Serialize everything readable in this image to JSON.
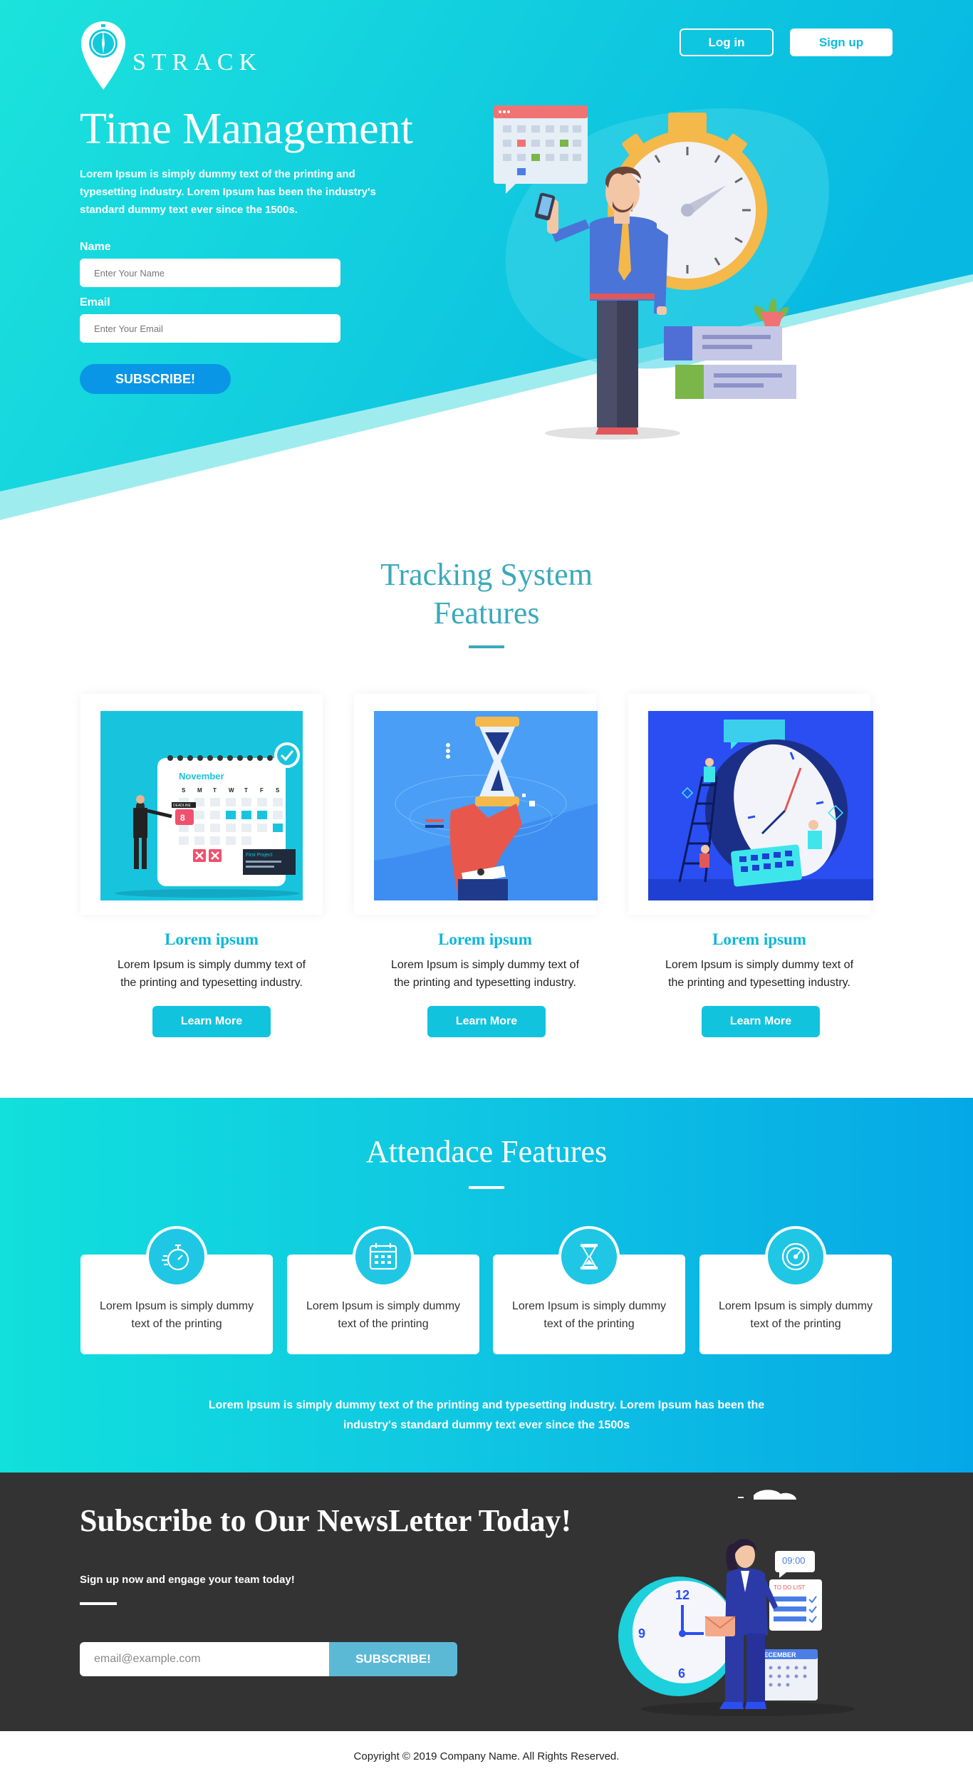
{
  "colors": {
    "primary": "#12c3dd",
    "hero_start": "#1ce3dc",
    "hero_end": "#07b8e2",
    "heading": "#3aa9bb",
    "dark": "#333333",
    "subscribe_btn": "#0a96e6"
  },
  "header": {
    "brand": "STRACK",
    "login_label": "Log in",
    "signup_label": "Sign up"
  },
  "hero": {
    "title": "Time Management",
    "description": "Lorem Ipsum is simply dummy text of the printing and typesetting industry. Lorem Ipsum has been the industry's standard dummy text ever since the 1500s.",
    "name_label": "Name",
    "name_placeholder": "Enter Your Name",
    "email_label": "Email",
    "email_placeholder": "Enter Your Email",
    "subscribe_label": "SUBSCRIBE!"
  },
  "tracking": {
    "title_line1": "Tracking System",
    "title_line2": "Features",
    "cards": [
      {
        "title": "Lorem ipsum",
        "text": "Lorem Ipsum is simply dummy text of the printing and typesetting industry.",
        "button": "Learn More",
        "illustration": "calendar-illustration",
        "calendar": {
          "month": "November",
          "days": [
            "S",
            "M",
            "T",
            "W",
            "T",
            "F",
            "S"
          ],
          "deadline": "DEADLINE",
          "date": "8",
          "project": "First Project"
        }
      },
      {
        "title": "Lorem ipsum",
        "text": "Lorem Ipsum is simply dummy text of the printing and typesetting industry.",
        "button": "Learn More",
        "illustration": "hourglass-illustration"
      },
      {
        "title": "Lorem ipsum",
        "text": "Lorem Ipsum is simply dummy text of the printing and typesetting industry.",
        "button": "Learn More",
        "illustration": "clock-team-illustration"
      }
    ]
  },
  "attendance": {
    "title": "Attendace Features",
    "items": [
      {
        "icon": "stopwatch-icon",
        "text": "Lorem Ipsum is simply dummy text of the printing"
      },
      {
        "icon": "calendar-icon",
        "text": "Lorem Ipsum is simply dummy text of the printing"
      },
      {
        "icon": "hourglass-icon",
        "text": "Lorem Ipsum is simply dummy text of the printing"
      },
      {
        "icon": "speedometer-icon",
        "text": "Lorem Ipsum is simply dummy text of the printing"
      }
    ],
    "note": "Lorem Ipsum is simply dummy text of the printing and typesetting industry. Lorem Ipsum has been the industry's standard dummy text ever since the 1500s"
  },
  "newsletter": {
    "title": "Subscribe to Our NewsLetter Today!",
    "subtitle": "Sign up now and engage your team today!",
    "email_placeholder": "email@example.com",
    "button": "SUBSCRIBE!",
    "illustration": {
      "clock_top": "12",
      "clock_left": "9",
      "clock_bottom": "6",
      "time_badge": "09:00",
      "list_badge": "TO DO LIST",
      "month": "DECEMBER"
    }
  },
  "footer": {
    "copyright": "Copyright © 2019 Company Name. All Rights Reserved."
  }
}
